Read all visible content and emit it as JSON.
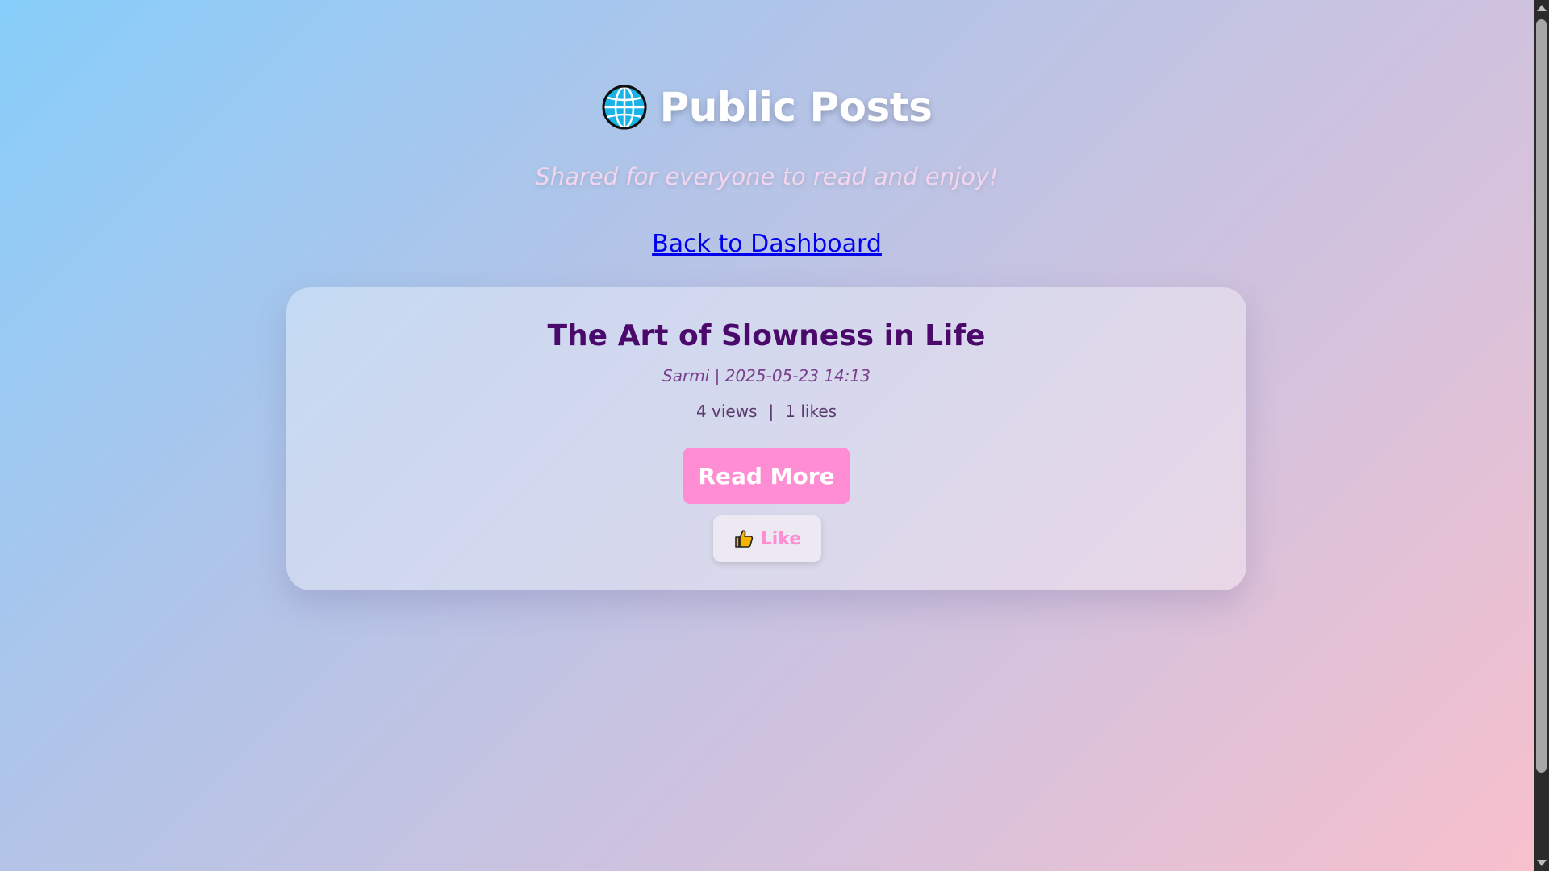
{
  "header": {
    "icon": "globe-icon",
    "title": "Public Posts",
    "subtitle": "Shared for everyone to read and enjoy!",
    "back_link": "Back to Dashboard"
  },
  "post": {
    "title": "The Art of Slowness in Life",
    "meta": "Sarmi | 2025-05-23 14:13",
    "views": "4 views",
    "separator": "|",
    "likes": "1 likes",
    "read_more_label": "Read More",
    "like_label": "Like",
    "like_icon": "thumbs-up-icon"
  },
  "colors": {
    "title": "#4b0a6b",
    "accent": "#ff8dd3",
    "link": "#0000ee",
    "gradient_start": "#87cefa",
    "gradient_end": "#f8c0cc"
  }
}
